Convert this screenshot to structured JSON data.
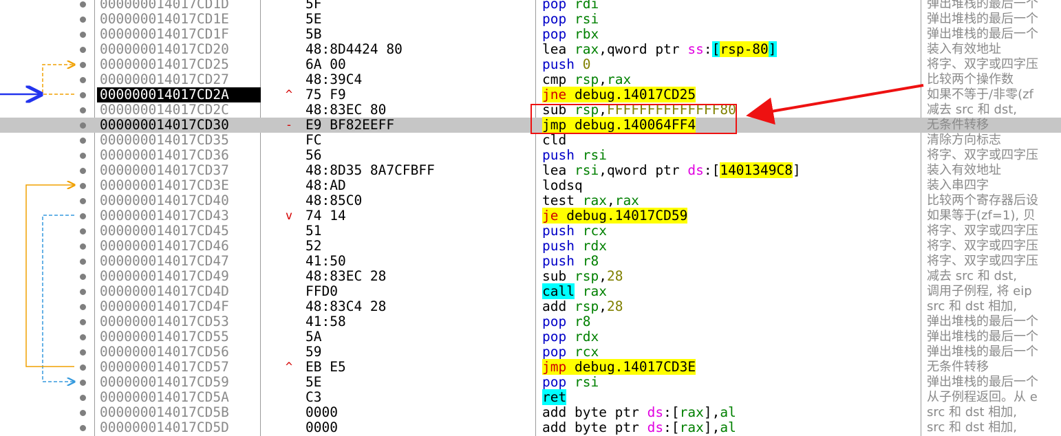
{
  "rows": [
    {
      "addr": "000000014017CD1D",
      "mark": "",
      "bytes": "5F",
      "dis": [
        {
          "t": "pop",
          "c": "mn"
        },
        {
          "t": " "
        },
        {
          "t": "rdi",
          "c": "reg"
        }
      ],
      "cmt": "弹出堆栈的最后一个"
    },
    {
      "addr": "000000014017CD1E",
      "mark": "",
      "bytes": "5E",
      "dis": [
        {
          "t": "pop",
          "c": "mn"
        },
        {
          "t": " "
        },
        {
          "t": "rsi",
          "c": "reg"
        }
      ],
      "cmt": "弹出堆栈的最后一个"
    },
    {
      "addr": "000000014017CD1F",
      "mark": "",
      "bytes": "5B",
      "dis": [
        {
          "t": "pop",
          "c": "mn"
        },
        {
          "t": " "
        },
        {
          "t": "rbx",
          "c": "reg"
        }
      ],
      "cmt": "弹出堆栈的最后一个"
    },
    {
      "addr": "000000014017CD20",
      "mark": "",
      "bytes": "48:8D4424 80",
      "dis": [
        {
          "t": "lea",
          "c": "txt"
        },
        {
          "t": " "
        },
        {
          "t": "rax",
          "c": "reg"
        },
        {
          "t": ",qword ptr ",
          "c": "txt"
        },
        {
          "t": "ss",
          "c": "seg"
        },
        {
          "t": ":",
          "c": "txt"
        },
        {
          "t": "[",
          "c": "bcy"
        },
        {
          "t": "rsp-80",
          "c": "mem"
        },
        {
          "t": "]",
          "c": "bcy"
        }
      ],
      "cmt": "装入有效地址"
    },
    {
      "addr": "000000014017CD25",
      "mark": "",
      "bytes": "6A 00",
      "dis": [
        {
          "t": "push",
          "c": "mn"
        },
        {
          "t": " "
        },
        {
          "t": "0",
          "c": "num"
        }
      ],
      "cmt": "将字、双字或四字压"
    },
    {
      "addr": "000000014017CD27",
      "mark": "",
      "bytes": "48:39C4",
      "dis": [
        {
          "t": "cmp",
          "c": "txt"
        },
        {
          "t": " "
        },
        {
          "t": "rsp",
          "c": "reg"
        },
        {
          "t": ",",
          "c": "txt"
        },
        {
          "t": "rax",
          "c": "reg"
        }
      ],
      "cmt": "比较两个操作数"
    },
    {
      "addr": "000000014017CD2A",
      "mark": "^",
      "bytes": "75 F9",
      "dis": [
        {
          "t": "jne",
          "c": "jmp"
        },
        {
          "t": " ",
          "c": "tgt"
        },
        {
          "t": "debug.14017CD25",
          "c": "tgt"
        }
      ],
      "cmt": "如果不等于/非零(zf",
      "cur": true
    },
    {
      "addr": "000000014017CD2C",
      "mark": "",
      "bytes": "48:83EC 80",
      "dis": [
        {
          "t": "sub",
          "c": "txt"
        },
        {
          "t": " "
        },
        {
          "t": "rsp",
          "c": "reg"
        },
        {
          "t": ",",
          "c": "txt"
        },
        {
          "t": "FFFFFFFFFFFFFF80",
          "c": "num"
        }
      ],
      "cmt": "减去 src 和 dst,"
    },
    {
      "addr": "000000014017CD30",
      "mark": "-",
      "bytes": "E9 BF82EEFF",
      "dis": [
        {
          "t": "jmp",
          "c": "tgt"
        },
        {
          "t": " ",
          "c": "tgt"
        },
        {
          "t": "debug.140064FF4",
          "c": "tgt"
        }
      ],
      "cmt": "无条件转移",
      "hl": true
    },
    {
      "addr": "000000014017CD35",
      "mark": "",
      "bytes": "FC",
      "dis": [
        {
          "t": "cld",
          "c": "txt"
        }
      ],
      "cmt": "清除方向标志"
    },
    {
      "addr": "000000014017CD36",
      "mark": "",
      "bytes": "56",
      "dis": [
        {
          "t": "push",
          "c": "mn"
        },
        {
          "t": " "
        },
        {
          "t": "rsi",
          "c": "reg"
        }
      ],
      "cmt": "将字、双字或四字压"
    },
    {
      "addr": "000000014017CD37",
      "mark": "",
      "bytes": "48:8D35 8A7CFBFF",
      "dis": [
        {
          "t": "lea",
          "c": "txt"
        },
        {
          "t": " "
        },
        {
          "t": "rsi",
          "c": "reg"
        },
        {
          "t": ",qword ptr ",
          "c": "txt"
        },
        {
          "t": "ds",
          "c": "seg"
        },
        {
          "t": ":[",
          "c": "txt"
        },
        {
          "t": "1401349C8",
          "c": "mem"
        },
        {
          "t": "]",
          "c": "txt"
        }
      ],
      "cmt": "装入有效地址"
    },
    {
      "addr": "000000014017CD3E",
      "mark": "",
      "bytes": "48:AD",
      "dis": [
        {
          "t": "lodsq",
          "c": "txt"
        }
      ],
      "cmt": "装入串四字"
    },
    {
      "addr": "000000014017CD40",
      "mark": "",
      "bytes": "48:85C0",
      "dis": [
        {
          "t": "test",
          "c": "txt"
        },
        {
          "t": " "
        },
        {
          "t": "rax",
          "c": "reg"
        },
        {
          "t": ",",
          "c": "txt"
        },
        {
          "t": "rax",
          "c": "reg"
        }
      ],
      "cmt": "比较两个寄存器后设"
    },
    {
      "addr": "000000014017CD43",
      "mark": "v",
      "bytes": "74 14",
      "dis": [
        {
          "t": "je",
          "c": "jmp"
        },
        {
          "t": " ",
          "c": "tgt"
        },
        {
          "t": "debug.14017CD59",
          "c": "tgt"
        }
      ],
      "cmt": "如果等于(zf=1), 贝"
    },
    {
      "addr": "000000014017CD45",
      "mark": "",
      "bytes": "51",
      "dis": [
        {
          "t": "push",
          "c": "mn"
        },
        {
          "t": " "
        },
        {
          "t": "rcx",
          "c": "reg"
        }
      ],
      "cmt": "将字、双字或四字压"
    },
    {
      "addr": "000000014017CD46",
      "mark": "",
      "bytes": "52",
      "dis": [
        {
          "t": "push",
          "c": "mn"
        },
        {
          "t": " "
        },
        {
          "t": "rdx",
          "c": "reg"
        }
      ],
      "cmt": "将字、双字或四字压"
    },
    {
      "addr": "000000014017CD47",
      "mark": "",
      "bytes": "41:50",
      "dis": [
        {
          "t": "push",
          "c": "mn"
        },
        {
          "t": " "
        },
        {
          "t": "r8",
          "c": "reg"
        }
      ],
      "cmt": "将字、双字或四字压"
    },
    {
      "addr": "000000014017CD49",
      "mark": "",
      "bytes": "48:83EC 28",
      "dis": [
        {
          "t": "sub",
          "c": "txt"
        },
        {
          "t": " "
        },
        {
          "t": "rsp",
          "c": "reg"
        },
        {
          "t": ",",
          "c": "txt"
        },
        {
          "t": "28",
          "c": "num"
        }
      ],
      "cmt": "减去 src 和 dst,"
    },
    {
      "addr": "000000014017CD4D",
      "mark": "",
      "bytes": "FFD0",
      "dis": [
        {
          "t": "call",
          "c": "call"
        },
        {
          "t": " "
        },
        {
          "t": "rax",
          "c": "reg"
        }
      ],
      "cmt": "调用子例程, 将 eip"
    },
    {
      "addr": "000000014017CD4F",
      "mark": "",
      "bytes": "48:83C4 28",
      "dis": [
        {
          "t": "add",
          "c": "txt"
        },
        {
          "t": " "
        },
        {
          "t": "rsp",
          "c": "reg"
        },
        {
          "t": ",",
          "c": "txt"
        },
        {
          "t": "28",
          "c": "num"
        }
      ],
      "cmt": "src 和 dst 相加,"
    },
    {
      "addr": "000000014017CD53",
      "mark": "",
      "bytes": "41:58",
      "dis": [
        {
          "t": "pop",
          "c": "mn"
        },
        {
          "t": " "
        },
        {
          "t": "r8",
          "c": "reg"
        }
      ],
      "cmt": "弹出堆栈的最后一个"
    },
    {
      "addr": "000000014017CD55",
      "mark": "",
      "bytes": "5A",
      "dis": [
        {
          "t": "pop",
          "c": "mn"
        },
        {
          "t": " "
        },
        {
          "t": "rdx",
          "c": "reg"
        }
      ],
      "cmt": "弹出堆栈的最后一个"
    },
    {
      "addr": "000000014017CD56",
      "mark": "",
      "bytes": "59",
      "dis": [
        {
          "t": "pop",
          "c": "mn"
        },
        {
          "t": " "
        },
        {
          "t": "rcx",
          "c": "reg"
        }
      ],
      "cmt": "弹出堆栈的最后一个"
    },
    {
      "addr": "000000014017CD57",
      "mark": "^",
      "bytes": "EB E5",
      "dis": [
        {
          "t": "jmp",
          "c": "jmp"
        },
        {
          "t": " ",
          "c": "tgt"
        },
        {
          "t": "debug.14017CD3E",
          "c": "tgt"
        }
      ],
      "cmt": "无条件转移"
    },
    {
      "addr": "000000014017CD59",
      "mark": "",
      "bytes": "5E",
      "dis": [
        {
          "t": "pop",
          "c": "mn"
        },
        {
          "t": " "
        },
        {
          "t": "rsi",
          "c": "reg"
        }
      ],
      "cmt": "弹出堆栈的最后一个"
    },
    {
      "addr": "000000014017CD5A",
      "mark": "",
      "bytes": "C3",
      "dis": [
        {
          "t": "ret",
          "c": "ret"
        }
      ],
      "cmt": "从子例程返回。从 e"
    },
    {
      "addr": "000000014017CD5B",
      "mark": "",
      "bytes": "0000",
      "dis": [
        {
          "t": "add",
          "c": "txt"
        },
        {
          "t": " byte ptr ",
          "c": "txt"
        },
        {
          "t": "ds",
          "c": "seg"
        },
        {
          "t": ":[",
          "c": "txt"
        },
        {
          "t": "rax",
          "c": "reg"
        },
        {
          "t": "],",
          "c": "txt"
        },
        {
          "t": "al",
          "c": "reg"
        }
      ],
      "cmt": "src 和 dst 相加,"
    },
    {
      "addr": "000000014017CD5D",
      "mark": "",
      "bytes": "0000",
      "dis": [
        {
          "t": "add",
          "c": "txt"
        },
        {
          "t": " byte ptr ",
          "c": "txt"
        },
        {
          "t": "ds",
          "c": "seg"
        },
        {
          "t": ":[",
          "c": "txt"
        },
        {
          "t": "rax",
          "c": "reg"
        },
        {
          "t": "],",
          "c": "txt"
        },
        {
          "t": "al",
          "c": "reg"
        }
      ],
      "cmt": "src 和 dst 相加,"
    }
  ],
  "colors": {
    "jump_arrow_active": "#f0a000",
    "jump_arrow_dashed": "#f0a000",
    "loop_arrow": "#f0a000",
    "je_arrow": "#3399dd",
    "eip_arrow": "#2233ee",
    "annotation": "#ee1111"
  }
}
